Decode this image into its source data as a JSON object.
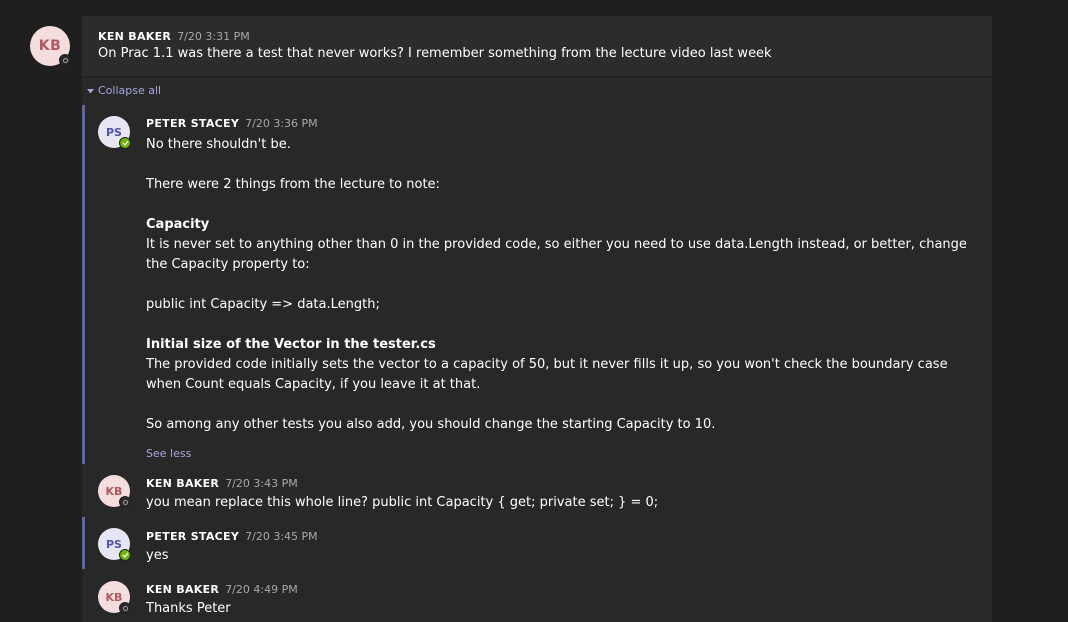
{
  "root": {
    "avatar_initials": "KB",
    "author": "KEN BAKER",
    "time": "7/20 3:31 PM",
    "text": "On Prac 1.1 was there a test that never works? I remember something from the lecture video last week",
    "presence": "offline"
  },
  "collapse_label": "Collapse all",
  "replies": [
    {
      "avatar_initials": "PS",
      "author": "PETER STACEY",
      "time": "7/20 3:36 PM",
      "presence": "available",
      "paragraphs": {
        "p1": "No there shouldn't be.",
        "p2": "There were 2 things from the lecture to note:",
        "h1": "Capacity",
        "p3": "It is never set to anything other than 0 in the provided code, so either you need to use data.Length instead, or better, change the Capacity property to:",
        "p4": "public int Capacity => data.Length;",
        "h2": "Initial size of the Vector in the tester.cs",
        "p5": "The provided code initially sets the vector to a capacity of 50, but it never fills it up, so you won't check the boundary case when Count equals Capacity, if you leave it at that.",
        "p6": "So among any other tests you also add, you should change the starting Capacity to 10."
      },
      "see_less": "See less"
    },
    {
      "avatar_initials": "KB",
      "author": "KEN BAKER",
      "time": "7/20 3:43 PM",
      "presence": "offline",
      "text": "you mean replace this whole line? public int Capacity { get; private set; } = 0;"
    },
    {
      "avatar_initials": "PS",
      "author": "PETER STACEY",
      "time": "7/20 3:45 PM",
      "presence": "available",
      "text": "yes"
    },
    {
      "avatar_initials": "KB",
      "author": "KEN BAKER",
      "time": "7/20 4:49 PM",
      "presence": "offline",
      "text": "Thanks Peter"
    }
  ],
  "colors": {
    "accent": "#6264a7",
    "link": "#a6a7dc",
    "available": "#6bb700"
  }
}
